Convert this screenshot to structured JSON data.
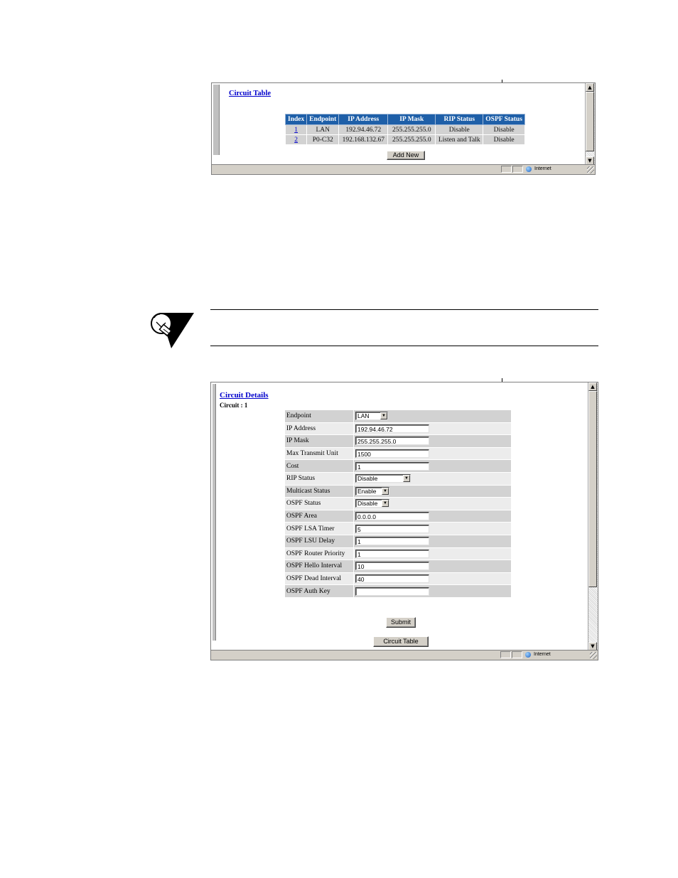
{
  "circuit_table_window": {
    "title": "Circuit Table",
    "columns": [
      "Index",
      "Endpoint",
      "IP Address",
      "IP Mask",
      "RIP Status",
      "OSPF Status"
    ],
    "rows": [
      {
        "index": "1",
        "endpoint": "LAN",
        "ip_address": "192.94.46.72",
        "ip_mask": "255.255.255.0",
        "rip_status": "Disable",
        "ospf_status": "Disable"
      },
      {
        "index": "2",
        "endpoint": "P0-C32",
        "ip_address": "192.168.132.67",
        "ip_mask": "255.255.255.0",
        "rip_status": "Listen and Talk",
        "ospf_status": "Disable"
      }
    ],
    "add_new_label": "Add New",
    "status_zone": "Internet"
  },
  "circuit_details_window": {
    "title": "Circuit Details",
    "subtitle": "Circuit : 1",
    "fields": [
      {
        "label": "Endpoint",
        "type": "select",
        "value": "LAN"
      },
      {
        "label": "IP Address",
        "type": "text",
        "value": "192.94.46.72"
      },
      {
        "label": "IP Mask",
        "type": "text",
        "value": "255.255.255.0"
      },
      {
        "label": "Max Transmit Unit",
        "type": "text",
        "value": "1500"
      },
      {
        "label": "Cost",
        "type": "text",
        "value": "1"
      },
      {
        "label": "RIP Status",
        "type": "select",
        "value": "Disable"
      },
      {
        "label": "Multicast Status",
        "type": "select",
        "value": "Enable"
      },
      {
        "label": "OSPF Status",
        "type": "select",
        "value": "Disable"
      },
      {
        "label": "OSPF Area",
        "type": "text",
        "value": "0.0.0.0"
      },
      {
        "label": "OSPF LSA Timer",
        "type": "text",
        "value": "5"
      },
      {
        "label": "OSPF LSU Delay",
        "type": "text",
        "value": "1"
      },
      {
        "label": "OSPF Router Priority",
        "type": "text",
        "value": "1"
      },
      {
        "label": "OSPF Hello Interval",
        "type": "text",
        "value": "10"
      },
      {
        "label": "OSPF Dead Interval",
        "type": "text",
        "value": "40"
      },
      {
        "label": "OSPF Auth Key",
        "type": "text",
        "value": ""
      }
    ],
    "submit_label": "Submit",
    "circuit_table_label": "Circuit Table",
    "status_zone": "Internet"
  },
  "icons": {
    "tip": "lightbulb-tip-icon",
    "status": "internet-globe-icon"
  },
  "colors": {
    "header_blue": "#1e5fa8",
    "link_blue": "#0000cc",
    "row_gray": "#d2d2d2"
  }
}
